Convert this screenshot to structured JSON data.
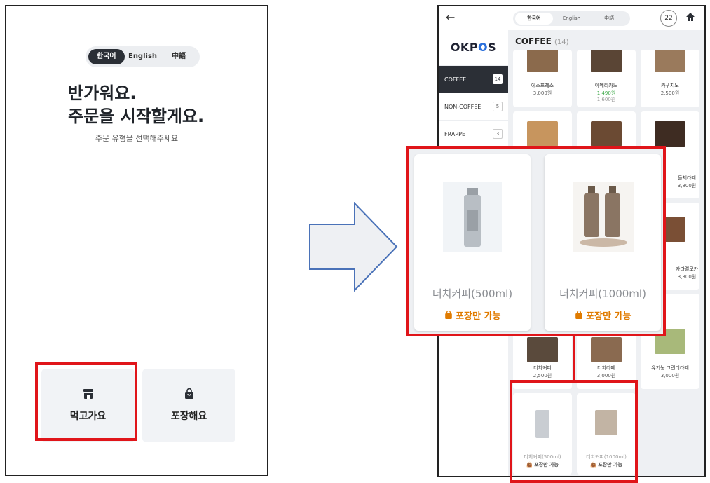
{
  "left": {
    "languages": [
      "한국어",
      "English",
      "中語"
    ],
    "active_language": 0,
    "headline_line1": "반가워요.",
    "headline_line2": "주문을 시작할게요.",
    "subtitle": "주문 유형을 선택해주세요",
    "dine_in_label": "먹고가요",
    "takeout_label": "포장해요"
  },
  "right": {
    "languages": [
      "한국어",
      "English",
      "中語"
    ],
    "cart_count": "22",
    "logo_text_pre": "OKP",
    "logo_ring": "O",
    "logo_text_post": "S",
    "categories": [
      {
        "label": "COFFEE",
        "count": "14",
        "active": true
      },
      {
        "label": "NON-COFFEE",
        "count": "5",
        "active": false
      },
      {
        "label": "FRAPPE",
        "count": "3",
        "active": false
      }
    ],
    "section_title": "COFFEE",
    "section_count": "(14)",
    "products": [
      {
        "name": "에스프레소",
        "price": "3,000원"
      },
      {
        "name": "아메리카노",
        "price": "1,490원",
        "orig_price": "1,600원"
      },
      {
        "name": "카푸치노",
        "price": "2,500원"
      },
      {
        "name": "돌체라떼",
        "price": "3,800원"
      },
      {
        "name": "카라멜모카",
        "price": "3,300원"
      },
      {
        "name": "더치커피",
        "price": "2,500원"
      },
      {
        "name": "더치라떼",
        "price": "3,000원"
      },
      {
        "name": "유기농 그린티라떼",
        "price": "3,000원"
      },
      {
        "name": "더치커피(500ml)",
        "tag": "포장만 가능"
      },
      {
        "name": "더치커피(1000ml)",
        "tag": "포장만 가능"
      }
    ]
  },
  "zoom": {
    "items": [
      {
        "name": "더치커피(500ml)",
        "tag": "포장만 가능"
      },
      {
        "name": "더치커피(1000ml)",
        "tag": "포장만 가능"
      }
    ]
  },
  "colors": {
    "highlight": "#e0151a",
    "takeout_tag": "#e07b00",
    "sale": "#3aa745",
    "dark": "#2b2f36"
  }
}
